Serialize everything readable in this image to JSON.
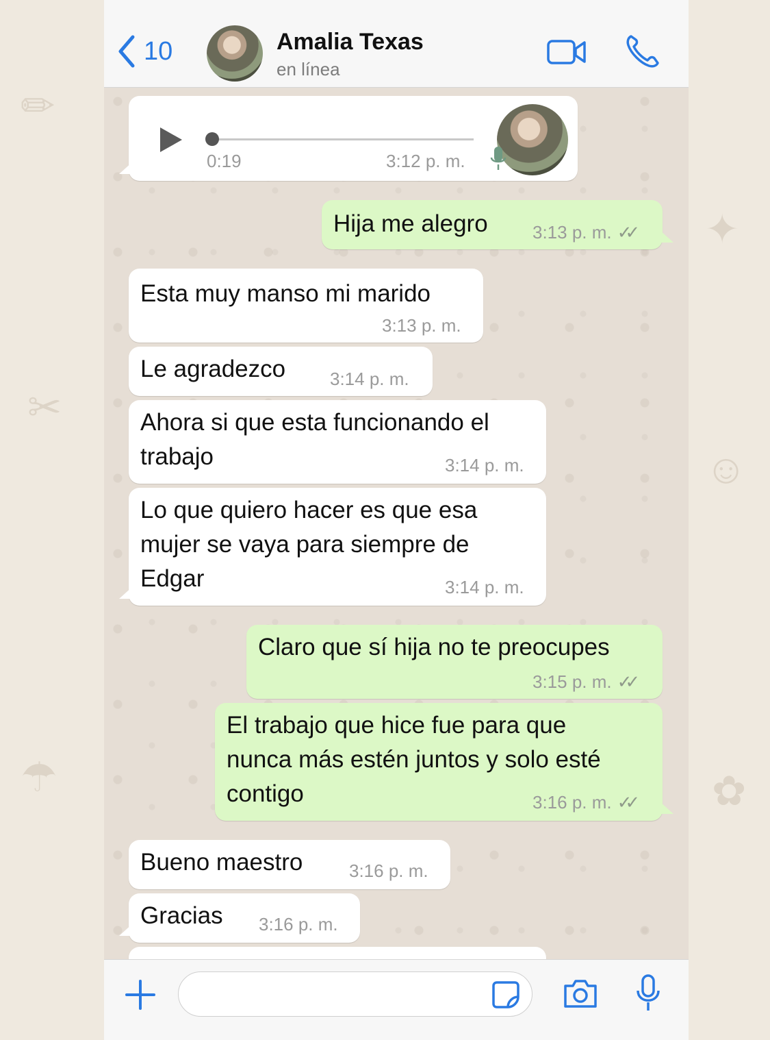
{
  "header": {
    "back_count": "10",
    "contact_name": "Amalia Texas",
    "status": "en línea",
    "icons": [
      "chevron-left-icon",
      "video-call-icon",
      "phone-call-icon"
    ]
  },
  "audio_message": {
    "duration": "0:19",
    "time": "3:12 p. m."
  },
  "messages": [
    {
      "direction": "outgoing",
      "text": "Hija me alegro",
      "time": "3:13 p. m.",
      "read": "✓✓"
    },
    {
      "direction": "incoming",
      "text": "Esta muy manso mi marido",
      "time": "3:13 p. m."
    },
    {
      "direction": "incoming",
      "text": "Le agradezco",
      "time": "3:14 p. m."
    },
    {
      "direction": "incoming",
      "text_lines": [
        "Ahora si que esta funcionando el",
        "trabajo"
      ],
      "time": "3:14 p. m."
    },
    {
      "direction": "incoming",
      "text_lines": [
        "Lo que quiero hacer es que esa",
        "mujer se vaya para siempre de",
        "Edgar"
      ],
      "time": "3:14 p. m."
    },
    {
      "direction": "outgoing",
      "text": "Claro que sí hija no te preocupes",
      "time": "3:15 p. m.",
      "read": "✓✓"
    },
    {
      "direction": "outgoing",
      "text_lines": [
        "El trabajo que hice fue para que",
        "nunca más estén juntos y solo esté",
        "contigo"
      ],
      "time": "3:16 p. m.",
      "read": "✓✓"
    },
    {
      "direction": "incoming",
      "text": "Bueno maestro",
      "time": "3:16 p. m."
    },
    {
      "direction": "incoming",
      "text": "Gracias",
      "time": "3:16 p. m."
    }
  ],
  "input_bar": {
    "placeholder": "",
    "icons": [
      "plus-icon",
      "sticker-icon",
      "camera-icon",
      "microphone-icon"
    ]
  },
  "colors": {
    "accent": "#2a7ae2",
    "outgoing_bubble": "#dcf8c6",
    "incoming_bubble": "#ffffff",
    "chat_background": "#e6ded5"
  }
}
